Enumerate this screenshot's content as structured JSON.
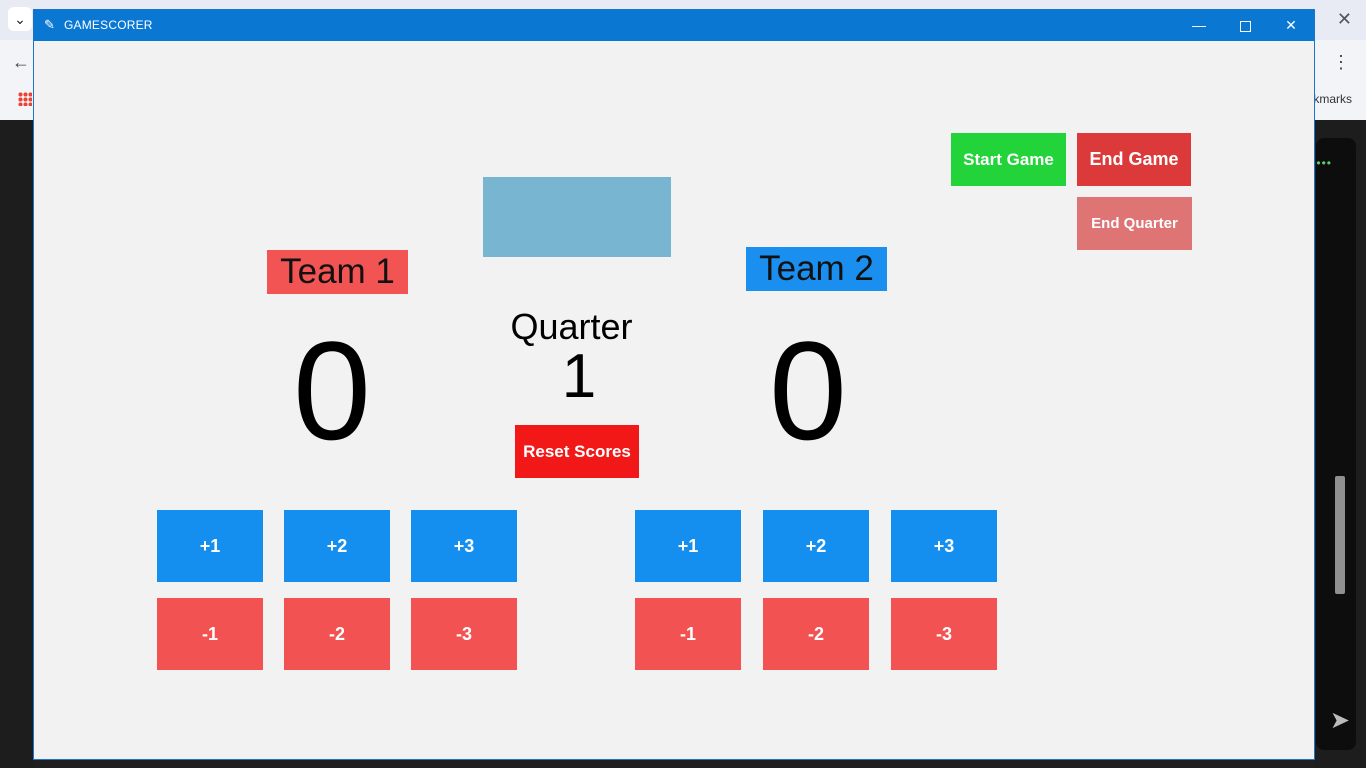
{
  "browser": {
    "bookmarks_text": "kmarks"
  },
  "window": {
    "title": "GAMESCORER",
    "minimize": "—",
    "close": "✕"
  },
  "controls": {
    "start_game": "Start Game",
    "end_game": "End Game",
    "end_quarter": "End Quarter",
    "reset_scores": "Reset Scores"
  },
  "quarter": {
    "label": "Quarter",
    "value": "1"
  },
  "team1": {
    "name": "Team 1",
    "score": "0",
    "plus": [
      "+1",
      "+2",
      "+3"
    ],
    "minus": [
      "-1",
      "-2",
      "-3"
    ]
  },
  "team2": {
    "name": "Team 2",
    "score": "0",
    "plus": [
      "+1",
      "+2",
      "+3"
    ],
    "minus": [
      "-1",
      "-2",
      "-3"
    ]
  },
  "colors": {
    "titlebar": "#0a78d3",
    "team1": "#f25454",
    "team2": "#1a8fef",
    "start": "#22d33a",
    "end": "#dc3a3a",
    "end_quarter": "#df7474",
    "reset": "#f21818",
    "plus": "#148ff0",
    "minus": "#f25252",
    "placeholder": "#78b5d0"
  },
  "icons": {
    "app": "feather-icon",
    "minimize": "minimize-icon",
    "maximize": "maximize-icon",
    "close": "close-icon"
  }
}
